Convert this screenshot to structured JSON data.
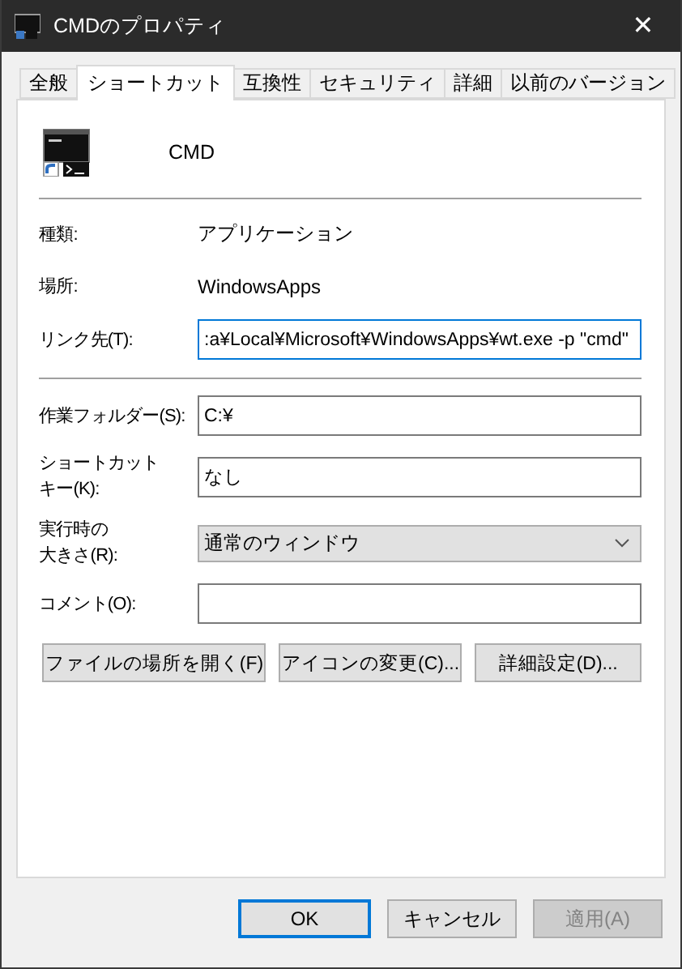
{
  "window": {
    "title": "CMDのプロパティ",
    "close": "✕"
  },
  "tabs": [
    {
      "label": "全般",
      "selected": false
    },
    {
      "label": "ショートカット",
      "selected": true
    },
    {
      "label": "互換性",
      "selected": false
    },
    {
      "label": "セキュリティ",
      "selected": false
    },
    {
      "label": "詳細",
      "selected": false
    },
    {
      "label": "以前のバージョン",
      "selected": false
    }
  ],
  "header": {
    "name": "CMD"
  },
  "sections": [
    {
      "rows": [
        {
          "kind": "info",
          "label": "種類:",
          "value": "アプリケーション"
        },
        {
          "kind": "info",
          "label": "場所:",
          "value": "WindowsApps"
        },
        {
          "kind": "input",
          "label": "リンク先(T):",
          "value": ":a¥Local¥Microsoft¥WindowsApps¥wt.exe -p \"cmd\"",
          "focused": true
        }
      ]
    },
    {
      "rows": [
        {
          "kind": "input",
          "label": "作業フォルダー(S):",
          "value": "C:¥",
          "focused": false
        },
        {
          "kind": "input",
          "label_lines": [
            "ショートカット",
            "キー(K):"
          ],
          "value": "なし",
          "focused": false
        },
        {
          "kind": "select",
          "label_lines": [
            "実行時の",
            "大きさ(R):"
          ],
          "value": "通常のウィンドウ"
        },
        {
          "kind": "input",
          "label": "コメント(O):",
          "value": "",
          "focused": false
        }
      ]
    }
  ],
  "actions": [
    "ファイルの場所を開く(F)",
    "アイコンの変更(C)...",
    "詳細設定(D)..."
  ],
  "buttons": [
    {
      "label": "OK",
      "default": true,
      "disabled": false
    },
    {
      "label": "キャンセル",
      "default": false,
      "disabled": false
    },
    {
      "label": "適用(A)",
      "default": false,
      "disabled": true
    }
  ]
}
